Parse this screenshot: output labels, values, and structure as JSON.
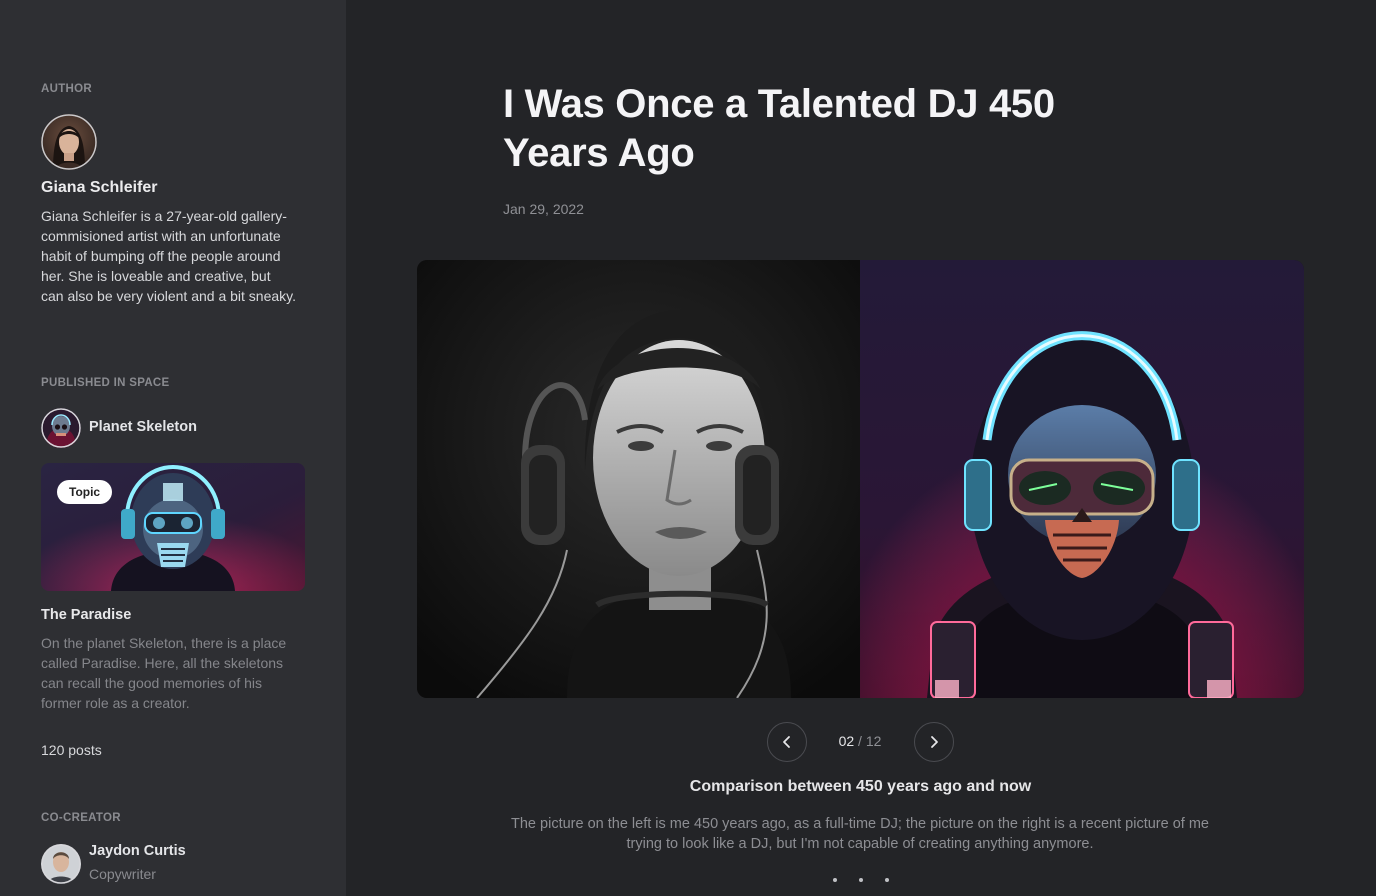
{
  "sidebar": {
    "author_label": "AUTHOR",
    "author": {
      "name": "Giana Schleifer",
      "bio": "Giana Schleifer is a 27-year-old gallery-commisioned artist with an unfortunate habit of bumping off the people around her. She is loveable and creative, but can also be very violent and a bit sneaky."
    },
    "space_label": "PUBLISHED IN SPACE",
    "space": {
      "name": "Planet Skeleton",
      "topic_badge": "Topic",
      "topic_title": "The Paradise",
      "topic_description": "On the planet Skeleton, there is a place called Paradise. Here, all the skeletons can recall the good memories of his former role as a creator.",
      "posts": "120 posts"
    },
    "cocreator_label": "CO-CREATOR",
    "cocreator": {
      "name": "Jaydon Curtis",
      "role": "Copywriter"
    }
  },
  "article": {
    "title": "I Was Once a Talented DJ 450 Years Ago",
    "date": "Jan 29, 2022",
    "gallery": {
      "current": "02",
      "separator": "/",
      "total": "12",
      "prev_icon": "chevron-left-icon",
      "next_icon": "chevron-right-icon"
    },
    "caption_title": "Comparison between 450 years ago and now",
    "caption_text": "The picture on the left is me 450 years ago, as a full-time DJ; the picture on the right is a recent picture of me trying to look like a DJ, but I'm not capable of creating anything anymore."
  },
  "colors": {
    "background": "#232427",
    "sidebar": "#2e2f33",
    "neon_cyan": "#6fe3ff",
    "neon_pink": "#ff2d6f"
  }
}
